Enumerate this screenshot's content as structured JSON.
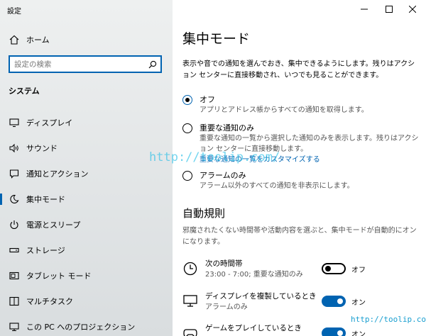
{
  "window": {
    "title": "設定"
  },
  "sidebar": {
    "home_label": "ホーム",
    "search_placeholder": "設定の検索",
    "section_title": "システム",
    "items": [
      {
        "label": "ディスプレイ",
        "icon": "display-icon"
      },
      {
        "label": "サウンド",
        "icon": "speaker-icon"
      },
      {
        "label": "通知とアクション",
        "icon": "notification-icon"
      },
      {
        "label": "集中モード",
        "icon": "moon-icon",
        "selected": true
      },
      {
        "label": "電源とスリープ",
        "icon": "power-icon"
      },
      {
        "label": "ストレージ",
        "icon": "storage-icon"
      },
      {
        "label": "タブレット モード",
        "icon": "tablet-icon"
      },
      {
        "label": "マルチタスク",
        "icon": "multitask-icon"
      },
      {
        "label": "この PC へのプロジェクション",
        "icon": "projection-icon"
      }
    ]
  },
  "main": {
    "title": "集中モード",
    "description": "表示や音での通知を選んでおき、集中できるようにします。残りはアクション センターに直接移動され、いつでも見ることができます。",
    "options": [
      {
        "label": "オフ",
        "sub": "アプリとアドレス帳からすべての通知を取得します。",
        "checked": true
      },
      {
        "label": "重要な通知のみ",
        "sub": "重要な通知の一覧から選択した通知のみを表示します。残りはアクション センターに直接移動します。",
        "link": "重要な通知の一覧をカスタマイズする",
        "checked": false
      },
      {
        "label": "アラームのみ",
        "sub": "アラーム以外のすべての通知を非表示にします。",
        "checked": false
      }
    ],
    "auto_rules": {
      "title": "自動規則",
      "description": "邪魔されたくない時間帯や活動内容を選ぶと、集中モードが自動的にオンになります。",
      "rules": [
        {
          "title": "次の時間帯",
          "sub": "23:00 - 7:00; 重要な通知のみ",
          "icon": "clock-icon",
          "state": "off",
          "state_label": "オフ"
        },
        {
          "title": "ディスプレイを複製しているとき",
          "sub": "アラームのみ",
          "icon": "monitor-icon",
          "state": "on",
          "state_label": "オン"
        },
        {
          "title": "ゲームをプレイしているとき",
          "sub": "",
          "icon": "gamepad-icon",
          "state": "on",
          "state_label": "オン"
        }
      ]
    }
  },
  "watermarks": {
    "center": "http://toolip.com/",
    "corner": "http://toolip.com/"
  },
  "colors": {
    "accent": "#0063b1",
    "sidebar_bg": "#e6e9ea"
  }
}
